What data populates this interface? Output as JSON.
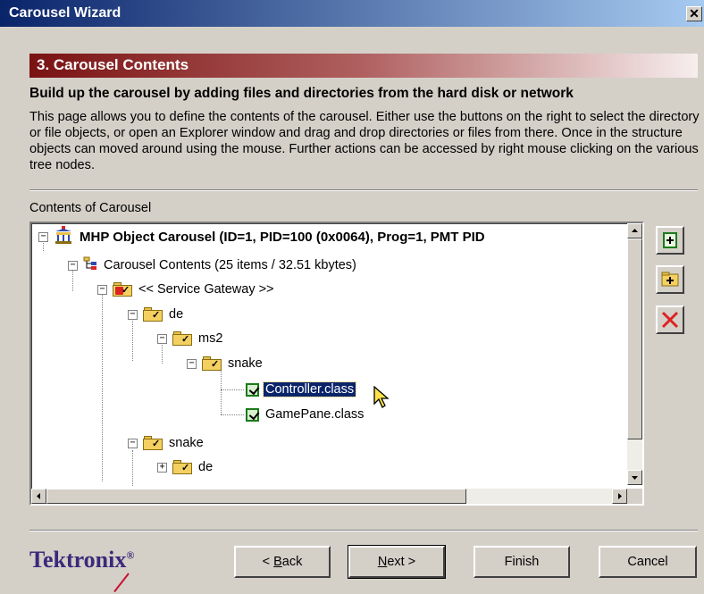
{
  "window": {
    "title": "Carousel Wizard",
    "close_glyph": "✕"
  },
  "step": {
    "title": "3. Carousel Contents",
    "subtitle": "Build up the carousel by adding files and directories from the hard disk or network",
    "description": "This page allows you to define the contents of the carousel. Either use the buttons on the right to select the directory or file objects, or open an Explorer window and drag and drop directories or files from there. Once in the structure objects can moved around using the mouse. Further actions can be accessed by right mouse clicking on the various tree nodes."
  },
  "contents": {
    "label": "Contents of Carousel",
    "tree": [
      {
        "label": "MHP Object Carousel (ID=1, PID=100 (0x0064), Prog=1, PMT PID",
        "icon": "carousel-icon",
        "expander": "−"
      },
      {
        "label": "Carousel Contents (25 items / 32.51 kbytes)",
        "icon": "structure-icon",
        "expander": "−"
      },
      {
        "label": "<< Service Gateway >>",
        "icon": "folder-icon",
        "expander": "−"
      },
      {
        "label": "de",
        "icon": "folder-icon",
        "expander": "−"
      },
      {
        "label": "ms2",
        "icon": "folder-icon",
        "expander": "−"
      },
      {
        "label": "snake",
        "icon": "folder-icon",
        "expander": "−"
      },
      {
        "label": "Controller.class",
        "icon": "class-file-icon",
        "selected": true
      },
      {
        "label": "GamePane.class",
        "icon": "class-file-icon"
      },
      {
        "label": "snake",
        "icon": "folder-icon",
        "expander": "−"
      },
      {
        "label": "de",
        "icon": "folder-icon",
        "expander": "+"
      }
    ]
  },
  "side_actions": [
    {
      "name": "add-file-button",
      "icon": "add-file-icon"
    },
    {
      "name": "add-directory-button",
      "icon": "add-directory-icon"
    },
    {
      "name": "delete-button",
      "icon": "delete-icon"
    }
  ],
  "brand": {
    "name": "Tektronix",
    "mark": "®"
  },
  "buttons": {
    "back": {
      "mnemonic": "B",
      "rest": "ack",
      "prefix": "< "
    },
    "next": {
      "mnemonic": "N",
      "rest": "ext",
      "suffix": " >"
    },
    "finish": "Finish",
    "cancel": "Cancel"
  },
  "colors": {
    "title_bar": "#0a246a",
    "hero": "#7a1212",
    "brand": "#3a2a7a",
    "selection": "#0a246a"
  }
}
